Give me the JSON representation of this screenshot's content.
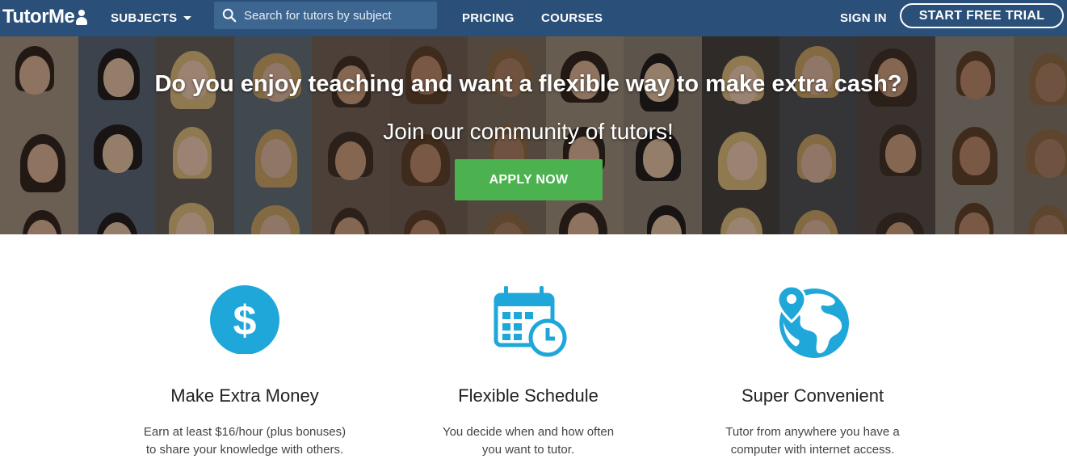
{
  "nav": {
    "logo_text": "TutorMe",
    "subjects_label": "SUBJECTS",
    "search_placeholder": "Search for tutors by subject",
    "pricing_label": "PRICING",
    "courses_label": "COURSES",
    "sign_in_label": "SIGN IN",
    "trial_label": "START FREE TRIAL"
  },
  "hero": {
    "title": "Do you enjoy teaching and want a flexible way to make extra cash?",
    "subtitle": "Join our community of tutors!",
    "cta_label": "APPLY NOW"
  },
  "features": [
    {
      "icon": "dollar-icon",
      "title": "Make Extra Money",
      "line1": "Earn at least $16/hour (plus bonuses)",
      "line2": "to share your knowledge with others."
    },
    {
      "icon": "calendar-clock-icon",
      "title": "Flexible Schedule",
      "line1": "You decide when and how often",
      "line2": "you want to tutor."
    },
    {
      "icon": "globe-pin-icon",
      "title": "Super Convenient",
      "line1": "Tutor from anywhere you have a",
      "line2": "computer with internet access."
    }
  ],
  "colors": {
    "nav_bg": "#2a4f78",
    "search_bg": "#3d6691",
    "cta_green": "#4cb14f",
    "icon_blue": "#1ea7d8"
  }
}
